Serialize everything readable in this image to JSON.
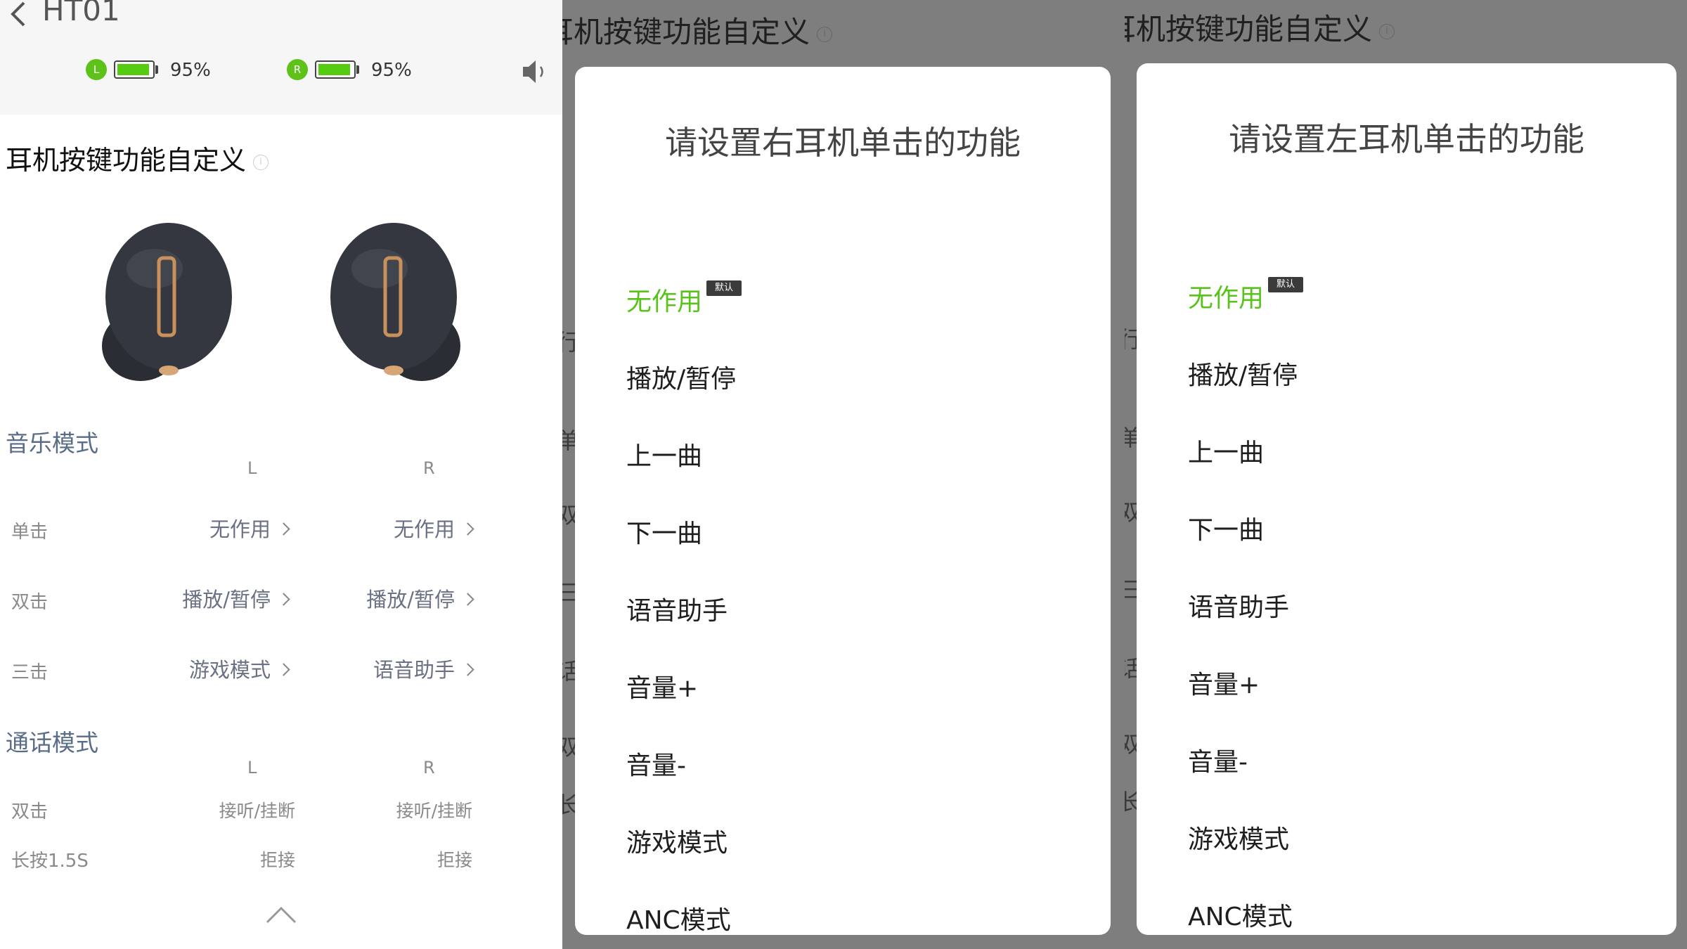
{
  "device": {
    "name": "HT01"
  },
  "battery": {
    "left": {
      "tag": "L",
      "level_percent": 95,
      "text": "95%"
    },
    "right": {
      "tag": "R",
      "level_percent": 95,
      "text": "95%"
    }
  },
  "section_title": "耳机按键功能自定义",
  "music_mode": {
    "title": "音乐模式",
    "col_left": "L",
    "col_right": "R",
    "rows": [
      {
        "label": "单击",
        "left": "无作用",
        "right": "无作用"
      },
      {
        "label": "双击",
        "left": "播放/暂停",
        "right": "播放/暂停"
      },
      {
        "label": "三击",
        "left": "游戏模式",
        "right": "语音助手"
      }
    ]
  },
  "call_mode": {
    "title": "通话模式",
    "col_left": "L",
    "col_right": "R",
    "rows": [
      {
        "label": "双击",
        "left": "接听/挂断",
        "right": "接听/挂断"
      },
      {
        "label": "长按1.5S",
        "left": "拒接",
        "right": "拒接"
      }
    ]
  },
  "dialog_right": {
    "background_title": "耳机按键功能自定义",
    "title": "请设置右耳机单击的功能",
    "default_badge": "默认",
    "selected_index": 0,
    "options": [
      "无作用",
      "播放/暂停",
      "上一曲",
      "下一曲",
      "语音助手",
      "音量+",
      "音量-",
      "游戏模式",
      "ANC模式"
    ]
  },
  "dialog_left": {
    "background_title": "耳机按键功能自定义",
    "title": "请设置左耳机单击的功能",
    "default_badge": "默认",
    "selected_index": 0,
    "options": [
      "无作用",
      "播放/暂停",
      "上一曲",
      "下一曲",
      "语音助手",
      "音量+",
      "音量-",
      "游戏模式",
      "ANC模式"
    ]
  },
  "colors": {
    "accent_green": "#59c31c",
    "battery_green": "#55cc11",
    "mode_title": "#5a6d86"
  },
  "icons": {
    "back": "chevron-left-icon",
    "speaker": "speaker-icon",
    "info": "info-icon",
    "collapse": "chevron-up-icon"
  }
}
